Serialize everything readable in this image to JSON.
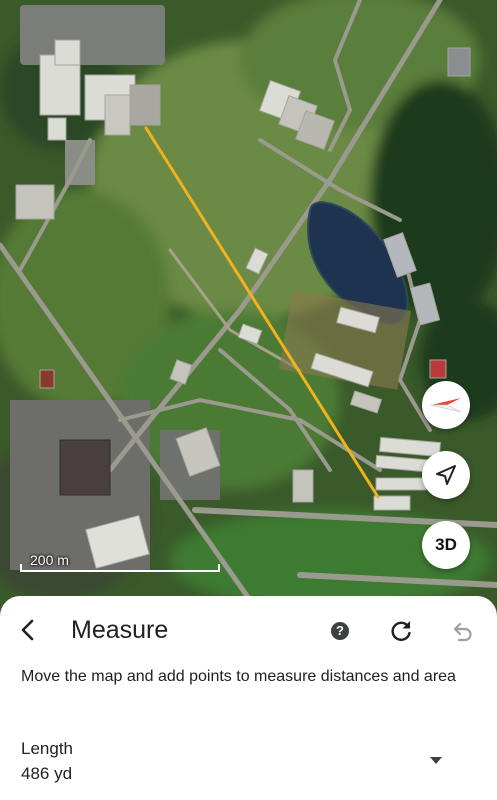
{
  "map": {
    "scale_label": "200 m",
    "measure_line_color": "#f2b21d",
    "controls": {
      "compass_icon": "compass-icon",
      "location_icon": "navigation-arrow-icon",
      "view_3d_label": "3D"
    }
  },
  "panel": {
    "title": "Measure",
    "back_icon": "back-arrow-icon",
    "help_icon": "help-icon",
    "help_glyph": "?",
    "reset_icon": "refresh-icon",
    "undo_icon": "undo-icon",
    "instruction": "Move the map and add points to measure distances and area",
    "measurement": {
      "label": "Length",
      "value": "486 yd",
      "dropdown_icon": "dropdown-arrow-icon"
    }
  }
}
